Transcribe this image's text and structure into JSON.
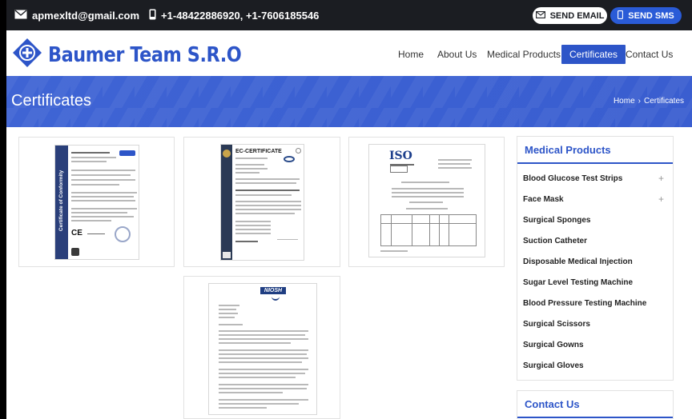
{
  "topbar": {
    "email": "apmexltd@gmail.com",
    "phones": "+1-48422886920, +1-7606185546",
    "send_email": "SEND EMAIL",
    "send_sms": "SEND SMS"
  },
  "header": {
    "brand": "Baumer Team S.R.O",
    "nav": [
      "Home",
      "About Us",
      "Medical Products",
      "Certificates",
      "Contact Us"
    ],
    "active_nav": "Certificates"
  },
  "banner": {
    "title": "Certificates",
    "breadcrumb_home": "Home",
    "breadcrumb_sep": "›",
    "breadcrumb_current": "Certificates"
  },
  "certificates": {
    "cert1_side_text": "Certificate of Conformity",
    "cert2_title": "EC-CERTIFICATE",
    "cert3_logo": "ISO",
    "cert4_logo": "NIOSH"
  },
  "sidebar": {
    "title": "Medical Products",
    "categories": [
      {
        "label": "Blood Glucose Test Strips",
        "expandable": true
      },
      {
        "label": "Face Mask",
        "expandable": true
      },
      {
        "label": "Surgical Sponges",
        "expandable": false
      },
      {
        "label": "Suction Catheter",
        "expandable": false
      },
      {
        "label": "Disposable Medical Injection",
        "expandable": false
      },
      {
        "label": "Sugar Level Testing Machine",
        "expandable": false
      },
      {
        "label": "Blood Pressure Testing Machine",
        "expandable": false
      },
      {
        "label": "Surgical Scissors",
        "expandable": false
      },
      {
        "label": "Surgical Gowns",
        "expandable": false
      },
      {
        "label": "Surgical Gloves",
        "expandable": false
      }
    ],
    "contact_title": "Contact Us"
  },
  "colors": {
    "brand_blue": "#2d55c8",
    "topbar_bg": "#1b1d22",
    "sms_button": "#2a5bd7"
  },
  "icons": {
    "email": "envelope-icon",
    "phone": "mobile-phone-icon",
    "nav_dropdown": "chevron-down-icon",
    "expand": "plus-icon"
  }
}
